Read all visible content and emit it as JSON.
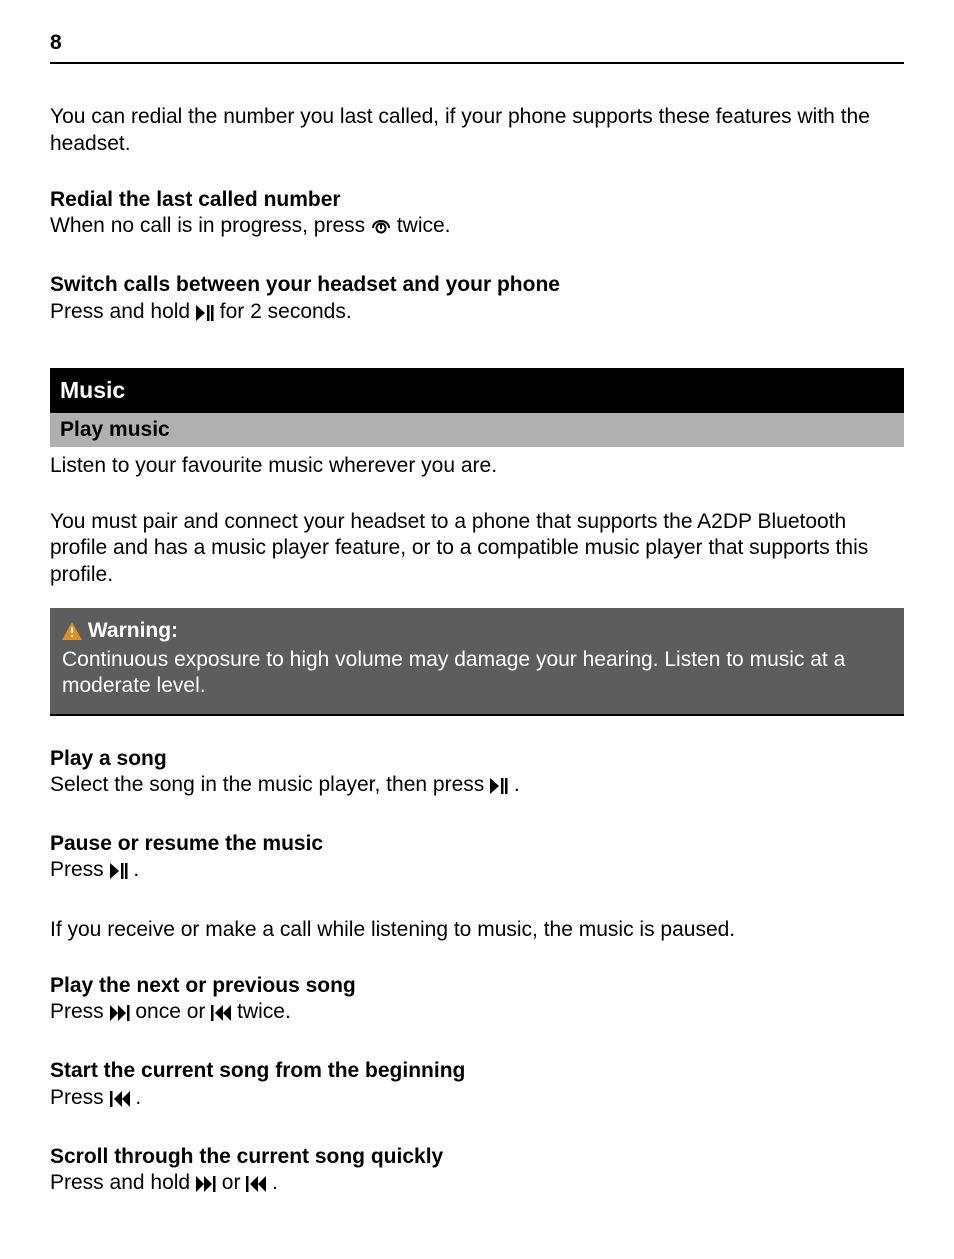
{
  "page_number": "8",
  "intro": "You can redial the number you last called, if your phone supports these features with the headset.",
  "redial": {
    "heading": "Redial the last called number",
    "text_before": "When no call is in progress, press ",
    "text_after": " twice."
  },
  "switch": {
    "heading": "Switch calls between your headset and your phone",
    "text_before": "Press and hold ",
    "text_after": " for 2 seconds."
  },
  "music_section": "Music",
  "play_music_sub": "Play music",
  "play_music_line": "Listen to your favourite music wherever you are.",
  "play_music_para": "You must pair and connect your headset to a phone that supports the A2DP Bluetooth profile and has a music player feature, or to a compatible music player that supports this profile.",
  "warning": {
    "label": "Warning:",
    "body": "Continuous exposure to high volume may damage your hearing. Listen to music at a moderate level."
  },
  "play_song": {
    "heading": "Play a song",
    "before": "Select the song in the music player, then press ",
    "after": "."
  },
  "pause": {
    "heading": "Pause or resume the music",
    "before": "Press ",
    "after": "."
  },
  "call_pause": "If you receive or make a call while listening to music, the music is paused.",
  "next_prev": {
    "heading": "Play the next or previous song",
    "p1": "Press ",
    "p2": " once or ",
    "p3": " twice."
  },
  "restart": {
    "heading": "Start the current song from the beginning",
    "before": "Press ",
    "after": "."
  },
  "scroll": {
    "heading": "Scroll through the current song quickly",
    "p1": "Press and hold ",
    "p2": " or ",
    "p3": "."
  }
}
